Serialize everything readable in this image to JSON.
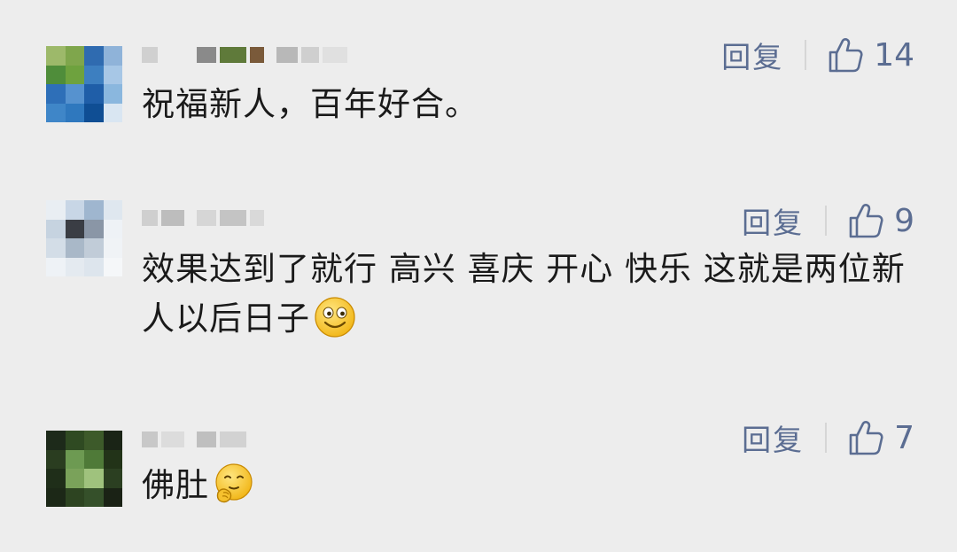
{
  "comments": [
    {
      "text": "祝福新人，百年好合。",
      "reply_label": "回复",
      "likes": "14",
      "avatar_colors": [
        "#9db96a",
        "#7fa64c",
        "#2f6bb0",
        "#8fb3d9",
        "#4f8d3a",
        "#6ea23e",
        "#3d7fc0",
        "#a7c7e6",
        "#2e6fb8",
        "#5692cf",
        "#1f5ea8",
        "#8ab7de",
        "#3f86c8",
        "#2f78be",
        "#0f4e94",
        "#d9e6f2"
      ],
      "username_blocks": [
        "#d0d0d0",
        "#ededed",
        "#8a8a8a",
        "#5f7a3a",
        "#7a5a3a",
        "#b8b8b8",
        "#cfcfcf",
        "#e0e0e0"
      ]
    },
    {
      "text": "效果达到了就行 高兴 喜庆 开心 快乐 这就是两位新人以后日子",
      "reply_label": "回复",
      "likes": "9",
      "avatar_colors": [
        "#e9eef3",
        "#c8d6e6",
        "#9fb6cf",
        "#dfe7ef",
        "#c6d3e0",
        "#3a3d44",
        "#8a96a6",
        "#eef2f6",
        "#d3dde7",
        "#a9b8c8",
        "#c1ccd8",
        "#f0f3f6",
        "#eef2f6",
        "#e4eaf0",
        "#dde5ed",
        "#f5f7f9"
      ],
      "username_blocks": [
        "#cfcfcf",
        "#bdbdbd",
        "#d6d6d6",
        "#c4c4c4",
        "#d9d9d9"
      ]
    },
    {
      "text": "佛肚",
      "reply_label": "回复",
      "likes": "7",
      "avatar_colors": [
        "#1d2a1a",
        "#2f4a22",
        "#3d5a2a",
        "#1a2416",
        "#2a3d20",
        "#6d9a52",
        "#4f7a38",
        "#223318",
        "#1f2e19",
        "#7aa25a",
        "#9fc27d",
        "#2b3f21",
        "#1c2817",
        "#2d4421",
        "#35502a",
        "#1a2215"
      ],
      "username_blocks": [
        "#c8c8c8",
        "#dcdcdc",
        "#bfbfbf",
        "#d2d2d2"
      ]
    }
  ]
}
